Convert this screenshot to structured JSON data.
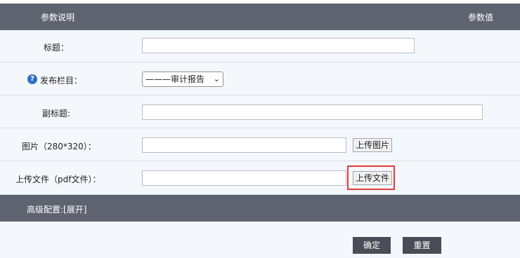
{
  "header": {
    "left_label": "参数说明",
    "right_label": "参数值"
  },
  "form": {
    "title_label": "标题：",
    "title_value": "",
    "category_label": "发布栏目：",
    "category_selected": "———审计报告",
    "subtitle_label": "副标题:",
    "subtitle_value": "",
    "image_label": "图片（280*320）：",
    "image_value": "",
    "image_upload_button": "上传图片",
    "file_label": "上传文件（pdf文件）：",
    "file_value": "",
    "file_upload_button": "上传文件"
  },
  "advanced": {
    "label": "高级配置:[展开]"
  },
  "actions": {
    "confirm_button": "确定",
    "reset_button": "重置"
  },
  "colors": {
    "header_bg": "#5f6370",
    "row_bg": "#f4f8fc",
    "highlight": "#e23b3b",
    "help_icon": "#2f6fc7",
    "dark_button": "#4a4d57"
  }
}
